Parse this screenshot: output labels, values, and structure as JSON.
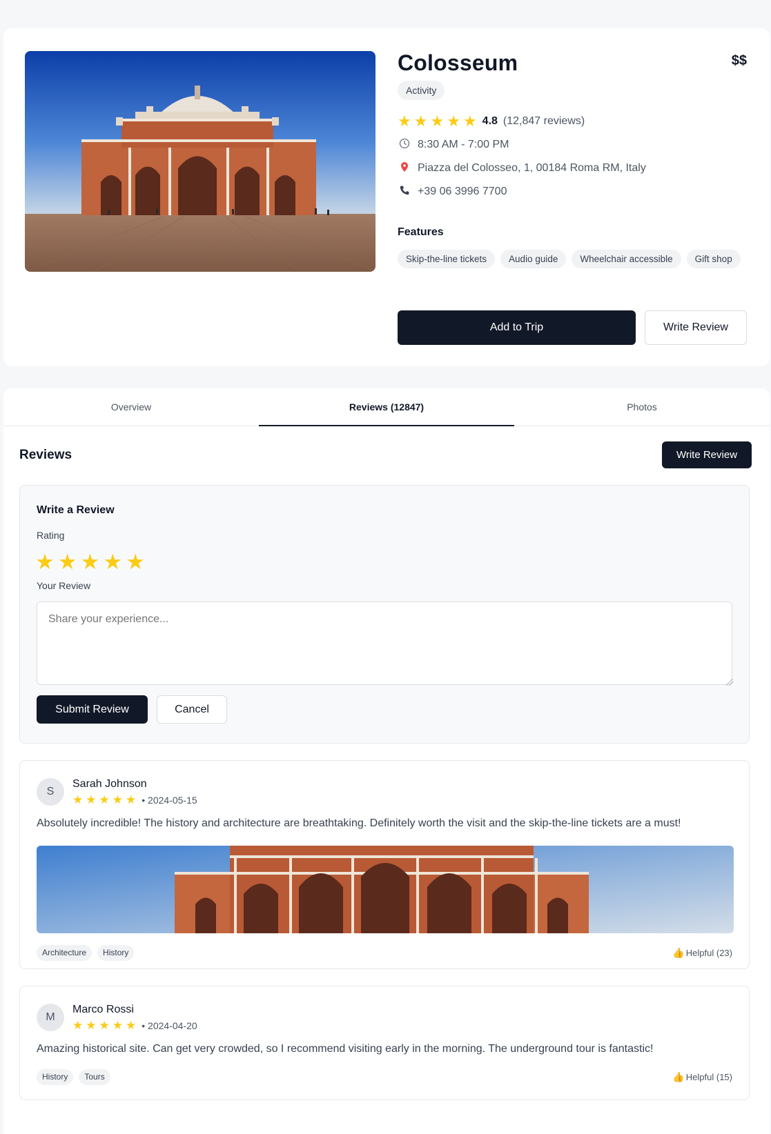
{
  "place": {
    "name": "Colosseum",
    "price": "$$",
    "type": "Activity",
    "rating": "4.8",
    "review_count": "(12,847 reviews)",
    "hours": "8:30 AM - 7:00 PM",
    "address": "Piazza del Colosseo, 1, 00184 Roma RM, Italy",
    "phone": "+39 06 3996 7700",
    "stars": 5
  },
  "features": {
    "heading": "Features",
    "items": [
      "Skip-the-line tickets",
      "Audio guide",
      "Wheelchair accessible",
      "Gift shop"
    ]
  },
  "actions": {
    "add_to_trip": "Add to Trip",
    "write_review": "Write Review"
  },
  "tabs": [
    "Overview",
    "Reviews (12847)",
    "Photos"
  ],
  "active_tab": "Reviews (12847)",
  "reviews_section": {
    "heading": "Reviews",
    "write_review_button": "Write Review"
  },
  "review_form": {
    "title": "Write a Review",
    "rating_label": "Rating",
    "review_label": "Your Review",
    "placeholder": "Share your experience...",
    "submit": "Submit Review",
    "cancel": "Cancel",
    "selected_stars": 5
  },
  "reviews": [
    {
      "initial": "S",
      "author": "Sarah Johnson",
      "stars": 5,
      "date": "• 2024-05-15",
      "text": "Absolutely incredible! The history and architecture are breathtaking. Definitely worth the visit and the skip-the-line tickets are a must!",
      "tags": [
        "Architecture",
        "History"
      ],
      "helpful": "Helpful (23)"
    },
    {
      "initial": "M",
      "author": "Marco Rossi",
      "stars": 5,
      "date": "• 2024-04-20",
      "text": "Amazing historical site. Can get very crowded, so I recommend visiting early in the morning. The underground tour is fantastic!",
      "tags": [
        "History",
        "Tours"
      ],
      "helpful": "Helpful (15)"
    }
  ],
  "icons": {
    "star": "star-icon",
    "clock": "clock-icon",
    "pin": "map-pin-icon",
    "phone": "phone-icon",
    "thumbs_up": "thumbs-up-icon"
  },
  "colors": {
    "primary": "#111827",
    "star": "#facc15",
    "chip_bg": "#f1f2f4",
    "page_bg": "#f6f7f9"
  }
}
